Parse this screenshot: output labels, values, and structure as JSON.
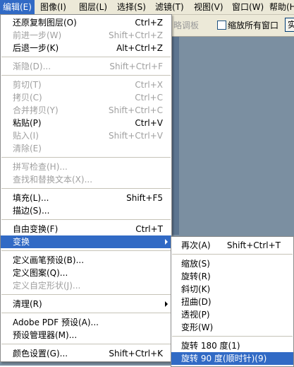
{
  "menubar": [
    {
      "label": "编辑(E)",
      "active": true
    },
    {
      "label": "图像(I)"
    },
    {
      "label": "图层(L)"
    },
    {
      "label": "选择(S)"
    },
    {
      "label": "滤镜(T)"
    },
    {
      "label": "视图(V)"
    },
    {
      "label": "窗口(W)"
    },
    {
      "label": "帮助(H)"
    }
  ],
  "options_bar": {
    "nav_hint": "略调板",
    "zoom_all_windows": "缩放所有窗口",
    "button_partial": "实"
  },
  "edit_menu": {
    "items": [
      {
        "label": "还原复制图层(O)",
        "shortcut": "Ctrl+Z"
      },
      {
        "label": "前进一步(W)",
        "shortcut": "Shift+Ctrl+Z",
        "disabled": true
      },
      {
        "label": "后退一步(K)",
        "shortcut": "Alt+Ctrl+Z"
      },
      {
        "sep": true
      },
      {
        "label": "渐隐(D)...",
        "shortcut": "Shift+Ctrl+F",
        "disabled": true
      },
      {
        "sep": true
      },
      {
        "label": "剪切(T)",
        "shortcut": "Ctrl+X",
        "disabled": true
      },
      {
        "label": "拷贝(C)",
        "shortcut": "Ctrl+C",
        "disabled": true
      },
      {
        "label": "合并拷贝(Y)",
        "shortcut": "Shift+Ctrl+C",
        "disabled": true
      },
      {
        "label": "粘贴(P)",
        "shortcut": "Ctrl+V"
      },
      {
        "label": "贴入(I)",
        "shortcut": "Shift+Ctrl+V",
        "disabled": true
      },
      {
        "label": "清除(E)",
        "disabled": true
      },
      {
        "sep": true
      },
      {
        "label": "拼写检查(H)...",
        "disabled": true
      },
      {
        "label": "查找和替换文本(X)...",
        "disabled": true
      },
      {
        "sep": true
      },
      {
        "label": "填充(L)...",
        "shortcut": "Shift+F5"
      },
      {
        "label": "描边(S)..."
      },
      {
        "sep": true
      },
      {
        "label": "自由变换(F)",
        "shortcut": "Ctrl+T"
      },
      {
        "label": "变换",
        "submenu": true,
        "highlighted": true
      },
      {
        "sep": true
      },
      {
        "label": "定义画笔预设(B)..."
      },
      {
        "label": "定义图案(Q)..."
      },
      {
        "label": "定义自定形状(J)...",
        "disabled": true
      },
      {
        "sep": true
      },
      {
        "label": "清理(R)",
        "submenu": true
      },
      {
        "sep": true
      },
      {
        "label": "Adobe PDF 预设(A)..."
      },
      {
        "label": "预设管理器(M)..."
      },
      {
        "sep": true
      },
      {
        "label": "颜色设置(G)...",
        "shortcut": "Shift+Ctrl+K"
      }
    ]
  },
  "transform_submenu": {
    "items": [
      {
        "label": "再次(A)",
        "shortcut": "Shift+Ctrl+T"
      },
      {
        "sep": true
      },
      {
        "label": "缩放(S)"
      },
      {
        "label": "旋转(R)"
      },
      {
        "label": "斜切(K)"
      },
      {
        "label": "扭曲(D)"
      },
      {
        "label": "透视(P)"
      },
      {
        "label": "变形(W)"
      },
      {
        "sep": true
      },
      {
        "label": "旋转 180 度(1)"
      },
      {
        "label": "旋转 90 度(顺时针)(9)",
        "highlighted": true
      }
    ]
  },
  "colors": {
    "highlight": "#316ac5",
    "menubar_bg": "#ece9d8",
    "workspace_bg": "#7b8fa1",
    "disabled_text": "#a0a0a0"
  }
}
